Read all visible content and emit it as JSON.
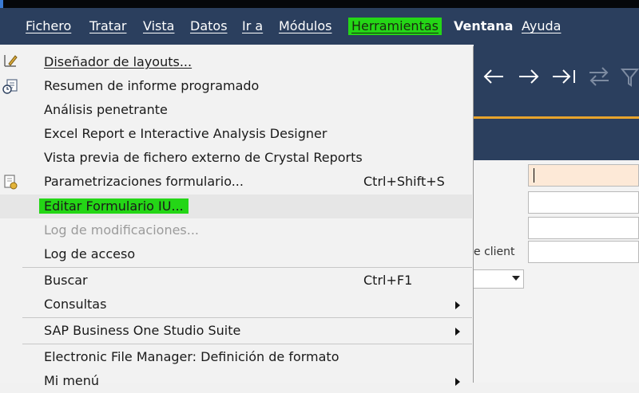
{
  "menubar": {
    "items": [
      "Fichero",
      "Tratar",
      "Vista",
      "Datos",
      "Ir a",
      "Módulos",
      "Herramientas",
      "Ventana",
      "Ayuda"
    ],
    "active": "Herramientas"
  },
  "toolbar": {
    "prev_icon": "arrow-left-icon",
    "next_icon": "arrow-right-icon",
    "last_icon": "arrow-to-end-icon",
    "swap_icon": "swap-arrows-icon",
    "filter_icon": "filter-icon"
  },
  "form": {
    "label_partial": "e client"
  },
  "menu": {
    "items": [
      {
        "label": "Diseñador de layouts...",
        "mnemonic": "D",
        "shortcut": "",
        "icon": "pen-design-icon"
      },
      {
        "label": "Resumen de informe programado",
        "mnemonic": "R",
        "shortcut": "",
        "icon": "scheduled-report-icon"
      },
      {
        "label": "Análisis penetrante",
        "mnemonic": "A",
        "shortcut": ""
      },
      {
        "label": "Excel Report e Interactive Analysis Designer",
        "mnemonic": "E",
        "shortcut": ""
      },
      {
        "label": "Vista previa de fichero externo de Crystal Reports",
        "mnemonic": "V",
        "shortcut": ""
      },
      {
        "label": "Parametrizaciones formulario...",
        "mnemonic": "P",
        "shortcut": "Ctrl+Shift+S",
        "icon": "form-settings-icon"
      },
      {
        "label": "Editar Formulario IU...",
        "mnemonic": "d",
        "shortcut": "",
        "state": "hover"
      },
      {
        "label": "Log de modificaciones...",
        "mnemonic": "L",
        "shortcut": "",
        "state": "disabled"
      },
      {
        "label": "Log de acceso",
        "mnemonic": "o",
        "shortcut": ""
      },
      {
        "label": "Buscar",
        "mnemonic": "u",
        "shortcut": "Ctrl+F1"
      },
      {
        "label": "Consultas",
        "mnemonic": "C",
        "shortcut": "",
        "submenu": true
      },
      {
        "label": "SAP Business One Studio Suite",
        "mnemonic": "S",
        "shortcut": "",
        "submenu": true
      },
      {
        "label": "Electronic File Manager: Definición de formato",
        "mnemonic": "",
        "shortcut": ""
      },
      {
        "label": "Mi menú",
        "mnemonic": "M",
        "shortcut": "",
        "submenu": true
      }
    ]
  },
  "colors": {
    "menubar_bg": "#2b3f5e",
    "highlight": "#24d616",
    "accent_line": "#e8a42c",
    "focused_field": "#fde9d7"
  }
}
